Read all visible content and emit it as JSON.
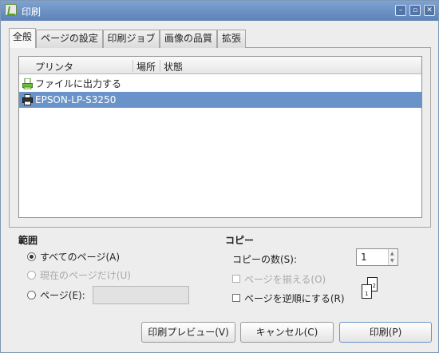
{
  "window": {
    "title": "印刷"
  },
  "titlebar_buttons": {
    "minimize": "–",
    "maximize": "▫",
    "close": "✕"
  },
  "tabs": [
    {
      "label": "全般",
      "active": true
    },
    {
      "label": "ページの設定"
    },
    {
      "label": "印刷ジョブ"
    },
    {
      "label": "画像の品質"
    },
    {
      "label": "拡張"
    }
  ],
  "printer_list": {
    "columns": [
      "プリンタ",
      "場所",
      "状態"
    ],
    "rows": [
      {
        "name": "ファイルに出力する",
        "icon": "file-printer-icon",
        "selected": false
      },
      {
        "name": "EPSON-LP-S3250",
        "icon": "printer-icon",
        "selected": true
      }
    ]
  },
  "range": {
    "heading": "範囲",
    "all_pages": "すべてのページ(A)",
    "current_page": "現在のページだけ(U)",
    "pages": "ページ(E):",
    "pages_value": ""
  },
  "copies": {
    "heading": "コピー",
    "count_label": "コピーの数(S):",
    "count_value": "1",
    "collate": "ページを揃える(O)",
    "reverse": "ページを逆順にする(R)"
  },
  "buttons": {
    "preview": "印刷プレビュー(V)",
    "cancel": "キャンセル(C)",
    "print": "印刷(P)"
  }
}
